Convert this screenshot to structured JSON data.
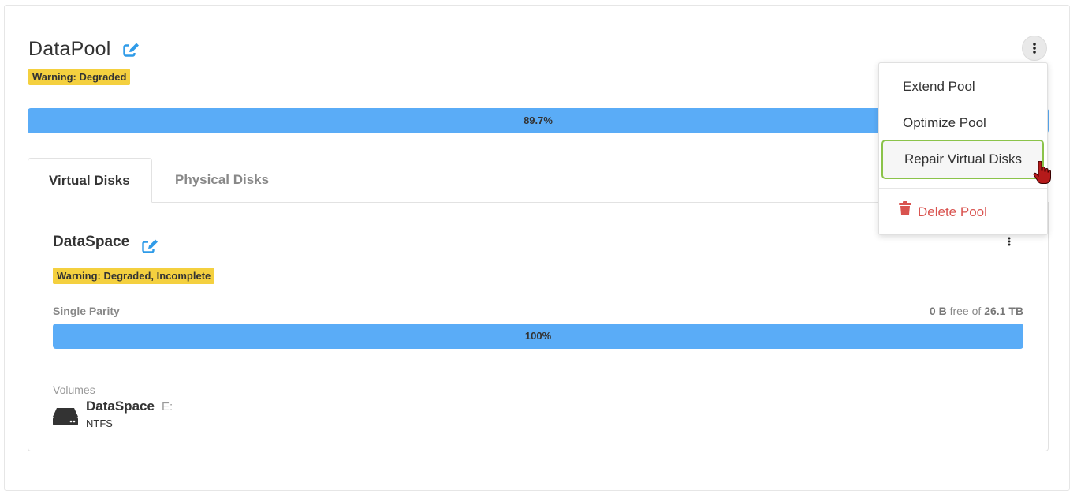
{
  "pool": {
    "name": "DataPool",
    "status": "Warning: Degraded",
    "usage_percent": 89.7,
    "usage_label": "89.7%",
    "menu_icon": "kebab-vertical-icon",
    "edit_icon": "edit-icon"
  },
  "tabs": [
    {
      "label": "Virtual Disks",
      "active": true
    },
    {
      "label": "Physical Disks",
      "active": false
    }
  ],
  "virtual_disk": {
    "name": "DataSpace",
    "status": "Warning: Degraded, Incomplete",
    "resiliency": "Single Parity",
    "free_value": "0 B",
    "free_text": "free of",
    "total_value": "26.1 TB",
    "usage_percent": 100,
    "usage_label": "100%"
  },
  "volumes": {
    "label": "Volumes",
    "items": [
      {
        "name": "DataSpace",
        "letter": "E:",
        "filesystem": "NTFS",
        "icon": "hard-drive-icon"
      }
    ]
  },
  "menu": {
    "items": [
      {
        "label": "Extend Pool"
      },
      {
        "label": "Optimize Pool"
      },
      {
        "label": "Repair Virtual Disks",
        "highlighted": true
      },
      {
        "label": "Delete Pool",
        "destructive": true,
        "icon": "trash-icon"
      }
    ]
  },
  "colors": {
    "progress": "#5aacf7",
    "warning_badge": "#f4d03f",
    "highlight_border": "#8bc34a",
    "delete": "#d9534f",
    "edit_icon": "#2f9be8"
  }
}
